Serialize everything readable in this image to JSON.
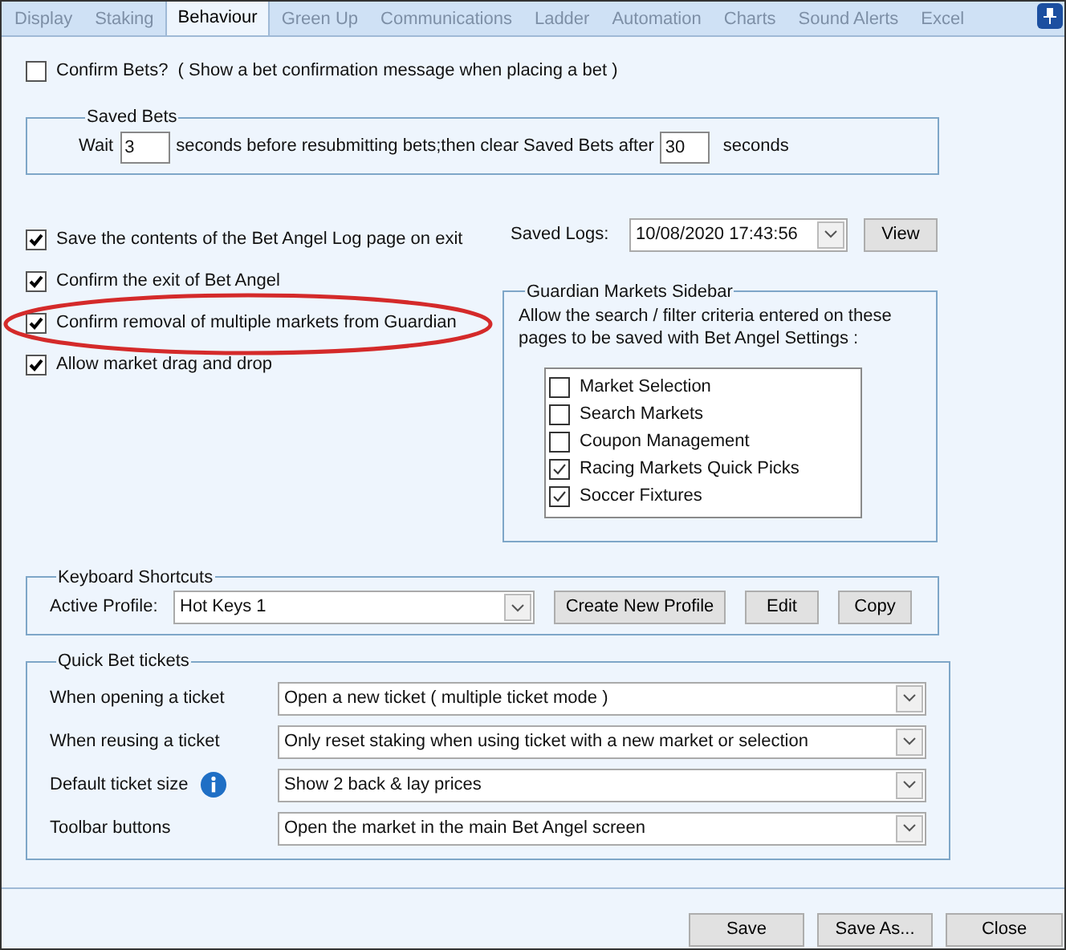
{
  "tabs": [
    {
      "label": "Display",
      "selected": false
    },
    {
      "label": "Staking",
      "selected": false
    },
    {
      "label": "Behaviour",
      "selected": true
    },
    {
      "label": "Green Up",
      "selected": false
    },
    {
      "label": "Communications",
      "selected": false
    },
    {
      "label": "Ladder",
      "selected": false
    },
    {
      "label": "Automation",
      "selected": false
    },
    {
      "label": "Charts",
      "selected": false
    },
    {
      "label": "Sound Alerts",
      "selected": false
    },
    {
      "label": "Excel",
      "selected": false
    }
  ],
  "confirm_bets": {
    "label": "Confirm Bets?  ( Show a bet confirmation message when placing a bet )",
    "checked": false
  },
  "saved_bets": {
    "title": "Saved Bets",
    "wait_label": "Wait",
    "wait_value": "3",
    "middle_text": "seconds before resubmitting bets;then clear Saved Bets after",
    "clear_value": "30",
    "end_text": "seconds"
  },
  "options": [
    {
      "label": "Save the contents of the Bet Angel Log page on exit",
      "checked": true,
      "highlighted": false
    },
    {
      "label": "Confirm the exit of Bet Angel",
      "checked": true,
      "highlighted": false
    },
    {
      "label": "Confirm removal of multiple markets from Guardian",
      "checked": true,
      "highlighted": true
    },
    {
      "label": "Allow market drag and drop",
      "checked": true,
      "highlighted": false
    }
  ],
  "saved_logs": {
    "label": "Saved Logs:",
    "value": "10/08/2020 17:43:56",
    "button": "View"
  },
  "guardian_sidebar": {
    "title": "Guardian Markets Sidebar",
    "description": "Allow the search / filter criteria entered on these pages to be saved with Bet Angel Settings :",
    "items": [
      {
        "label": "Market Selection",
        "checked": false
      },
      {
        "label": "Search Markets",
        "checked": false
      },
      {
        "label": "Coupon Management",
        "checked": false
      },
      {
        "label": "Racing Markets Quick Picks",
        "checked": true
      },
      {
        "label": "Soccer Fixtures",
        "checked": true
      }
    ]
  },
  "keyboard_shortcuts": {
    "title": "Keyboard Shortcuts",
    "profile_label": "Active Profile:",
    "profile_value": "Hot Keys 1",
    "buttons": [
      "Create New Profile",
      "Edit",
      "Copy"
    ]
  },
  "quick_bet_tickets": {
    "title": "Quick Bet tickets",
    "rows": [
      {
        "label": "When opening a ticket",
        "value": "Open a new ticket ( multiple ticket mode )",
        "info": false
      },
      {
        "label": "When reusing a ticket",
        "value": "Only reset staking when using ticket with a new market or selection",
        "info": false
      },
      {
        "label": "Default ticket size",
        "value": "Show 2 back & lay prices",
        "info": true
      },
      {
        "label": "Toolbar buttons",
        "value": "Open the market in the main Bet Angel screen",
        "info": false
      }
    ]
  },
  "footer_buttons": [
    "Save",
    "Save As...",
    "Close"
  ]
}
